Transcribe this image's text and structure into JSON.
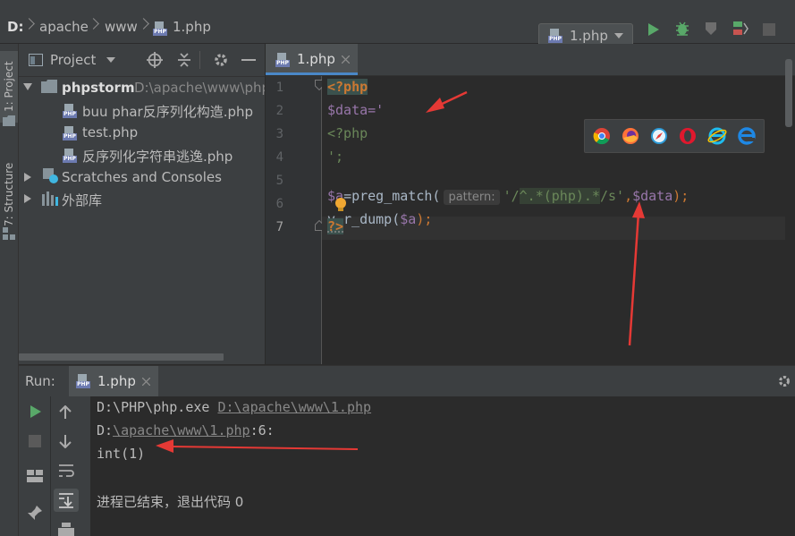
{
  "navbar": {
    "drive": "D:",
    "crumb1": "apache",
    "crumb2": "www",
    "file": "1.php",
    "run_config": "1.php"
  },
  "left_stripe": {
    "project_tab": "1: Project",
    "structure_tab": "7: Structure"
  },
  "project_panel": {
    "title": "Project",
    "root_name": "phpstorm",
    "root_path": "D:\\apache\\www\\php",
    "files": [
      "buu phar反序列化构造.php",
      "test.php",
      "反序列化字符串逃逸.php"
    ],
    "scratches": "Scratches and Consoles",
    "external_libs": "外部库"
  },
  "editor": {
    "tab_label": "1.php",
    "line_numbers": [
      "1",
      "2",
      "3",
      "4",
      "5",
      "6",
      "7"
    ],
    "param_hint": "pattern:",
    "lines": {
      "l1": "<?php",
      "l2": "$data='",
      "l3": "<?php",
      "l4": "';",
      "l5_a": "$a",
      "l5_b": "=preg_match(",
      "l5_c": "'/",
      "l5_d": "^.*(php).*",
      "l5_e": "/s'",
      "l5_f": ",",
      "l5_g": "$data",
      "l5_h": ");",
      "l6_a": "v",
      "l6_b": "r_dump(",
      "l6_c": "$a",
      "l6_d": ");",
      "l7": "?>"
    },
    "browsers": [
      "chrome-icon",
      "firefox-icon",
      "safari-icon",
      "opera-icon",
      "ie-icon",
      "edge-icon"
    ]
  },
  "run_panel": {
    "label": "Run:",
    "tab": "1.php",
    "console": {
      "line1_prefix": "D:\\PHP\\php.exe ",
      "line1_link": "D:\\apache\\www\\1.php",
      "line2_prefix": "D:",
      "line2_link": "\\apache\\www\\1.php",
      "line2_suffix": ":6:",
      "line3": "int(1)",
      "line5": "进程已结束，退出代码 0"
    }
  },
  "colors": {
    "keyword": "#cc7832",
    "variable": "#9876aa",
    "string": "#6a8759",
    "tag_bg": "#3b514d",
    "annotation_red": "#e53935"
  }
}
